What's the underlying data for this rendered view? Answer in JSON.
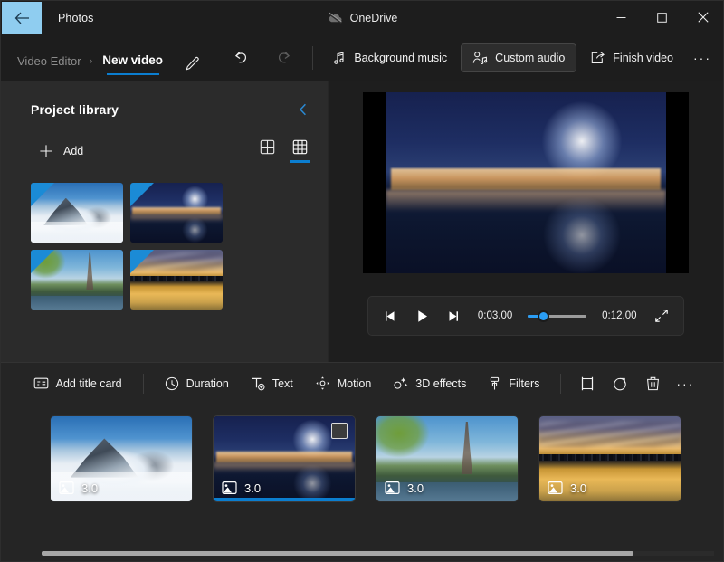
{
  "window": {
    "back_icon": "back-arrow-icon",
    "app_title": "Photos",
    "onedrive_label": "OneDrive",
    "onedrive_icon": "cloud-offline-icon",
    "minimize_label": "─",
    "maximize_label": "☐",
    "close_label": "✕",
    "accent_blue": "#0b7ed0",
    "back_btn_bg": "#8fcdf0"
  },
  "commandbar": {
    "breadcrumb_parent": "Video Editor",
    "breadcrumb_separator": "›",
    "breadcrumb_current": "New video",
    "rename_icon": "pencil-icon",
    "undo_icon": "undo-arrow-icon",
    "redo_icon": "redo-arrow-icon",
    "actions": [
      {
        "label": "Background music",
        "icon": "music-note-icon",
        "selected": false
      },
      {
        "label": "Custom audio",
        "icon": "person-audio-icon",
        "selected": true
      },
      {
        "label": "Finish video",
        "icon": "share-export-icon",
        "selected": false
      }
    ],
    "more_label": "···"
  },
  "library": {
    "title": "Project library",
    "collapse_icon": "chevron-left-icon",
    "add_label": "Add",
    "add_icon": "plus-icon",
    "views": [
      {
        "name": "grid-view-large-icon",
        "active": false
      },
      {
        "name": "grid-view-small-icon",
        "active": true
      }
    ],
    "items": [
      {
        "name": "snowy-mountain",
        "art": "art-mountain"
      },
      {
        "name": "night-city-dome",
        "art": "art-dome"
      },
      {
        "name": "eiffel-tower",
        "art": "art-eiffel"
      },
      {
        "name": "sunset-skyline",
        "art": "art-sunset"
      }
    ]
  },
  "preview": {
    "art": "art-dome",
    "prev_frame_icon": "previous-frame-icon",
    "play_icon": "play-icon",
    "next_frame_icon": "next-frame-icon",
    "current_time": "0:03.00",
    "total_time": "0:12.00",
    "fullscreen_icon": "expand-diagonal-icon",
    "slider_value_pct": 14
  },
  "storyboard": {
    "tools": [
      {
        "label": "Add title card",
        "icon": "title-card-icon"
      },
      {
        "label": "Duration",
        "icon": "clock-icon"
      },
      {
        "label": "Text",
        "icon": "text-t-icon"
      },
      {
        "label": "Motion",
        "icon": "motion-move-icon"
      },
      {
        "label": "3D effects",
        "icon": "3d-sparkle-icon"
      },
      {
        "label": "Filters",
        "icon": "filter-brush-icon"
      }
    ],
    "icon_tools": [
      {
        "name": "crop-resize-icon"
      },
      {
        "name": "rotate-icon"
      },
      {
        "name": "delete-trash-icon"
      },
      {
        "name": "more-options-icon",
        "glyph": "···"
      }
    ],
    "cards": [
      {
        "name": "storyboard-card-mountain",
        "duration": "3.0",
        "art": "art-mountain",
        "selected": false,
        "badge_icon": "photo-icon"
      },
      {
        "name": "storyboard-card-dome",
        "duration": "3.0",
        "art": "art-dome",
        "selected": true,
        "badge_icon": "photo-icon"
      },
      {
        "name": "storyboard-card-eiffel",
        "duration": "3.0",
        "art": "art-eiffel",
        "selected": false,
        "badge_icon": "photo-icon"
      },
      {
        "name": "storyboard-card-sunset",
        "duration": "3.0",
        "art": "art-sunset",
        "selected": false,
        "badge_icon": "photo-icon"
      }
    ]
  }
}
